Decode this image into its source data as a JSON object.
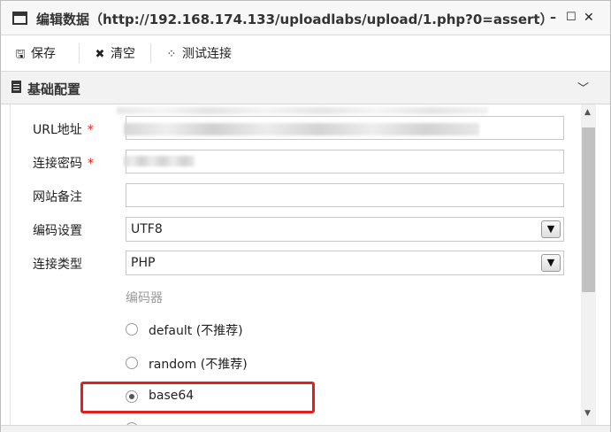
{
  "window": {
    "title": "编辑数据（http://192.168.174.133/uploadlabs/upload/1.php?0=assert）",
    "minimize": "–",
    "maximize": "☐",
    "close": "✕"
  },
  "toolbar": {
    "save_label": "保存",
    "clear_label": "清空",
    "test_label": "测试连接"
  },
  "section": {
    "title": "基础配置"
  },
  "form": {
    "url_label": "URL地址",
    "password_label": "连接密码",
    "note_label": "网站备注",
    "encoding_label": "编码设置",
    "encoding_value": "UTF8",
    "type_label": "连接类型",
    "type_value": "PHP",
    "required_mark": "*",
    "encoder_group_label": "编码器",
    "encoders": [
      {
        "label": "default (不推荐)",
        "checked": false
      },
      {
        "label": "random (不推荐)",
        "checked": false
      },
      {
        "label": "base64",
        "checked": true
      }
    ]
  },
  "colors": {
    "required": "#e02020",
    "highlight": "#e0201e"
  }
}
